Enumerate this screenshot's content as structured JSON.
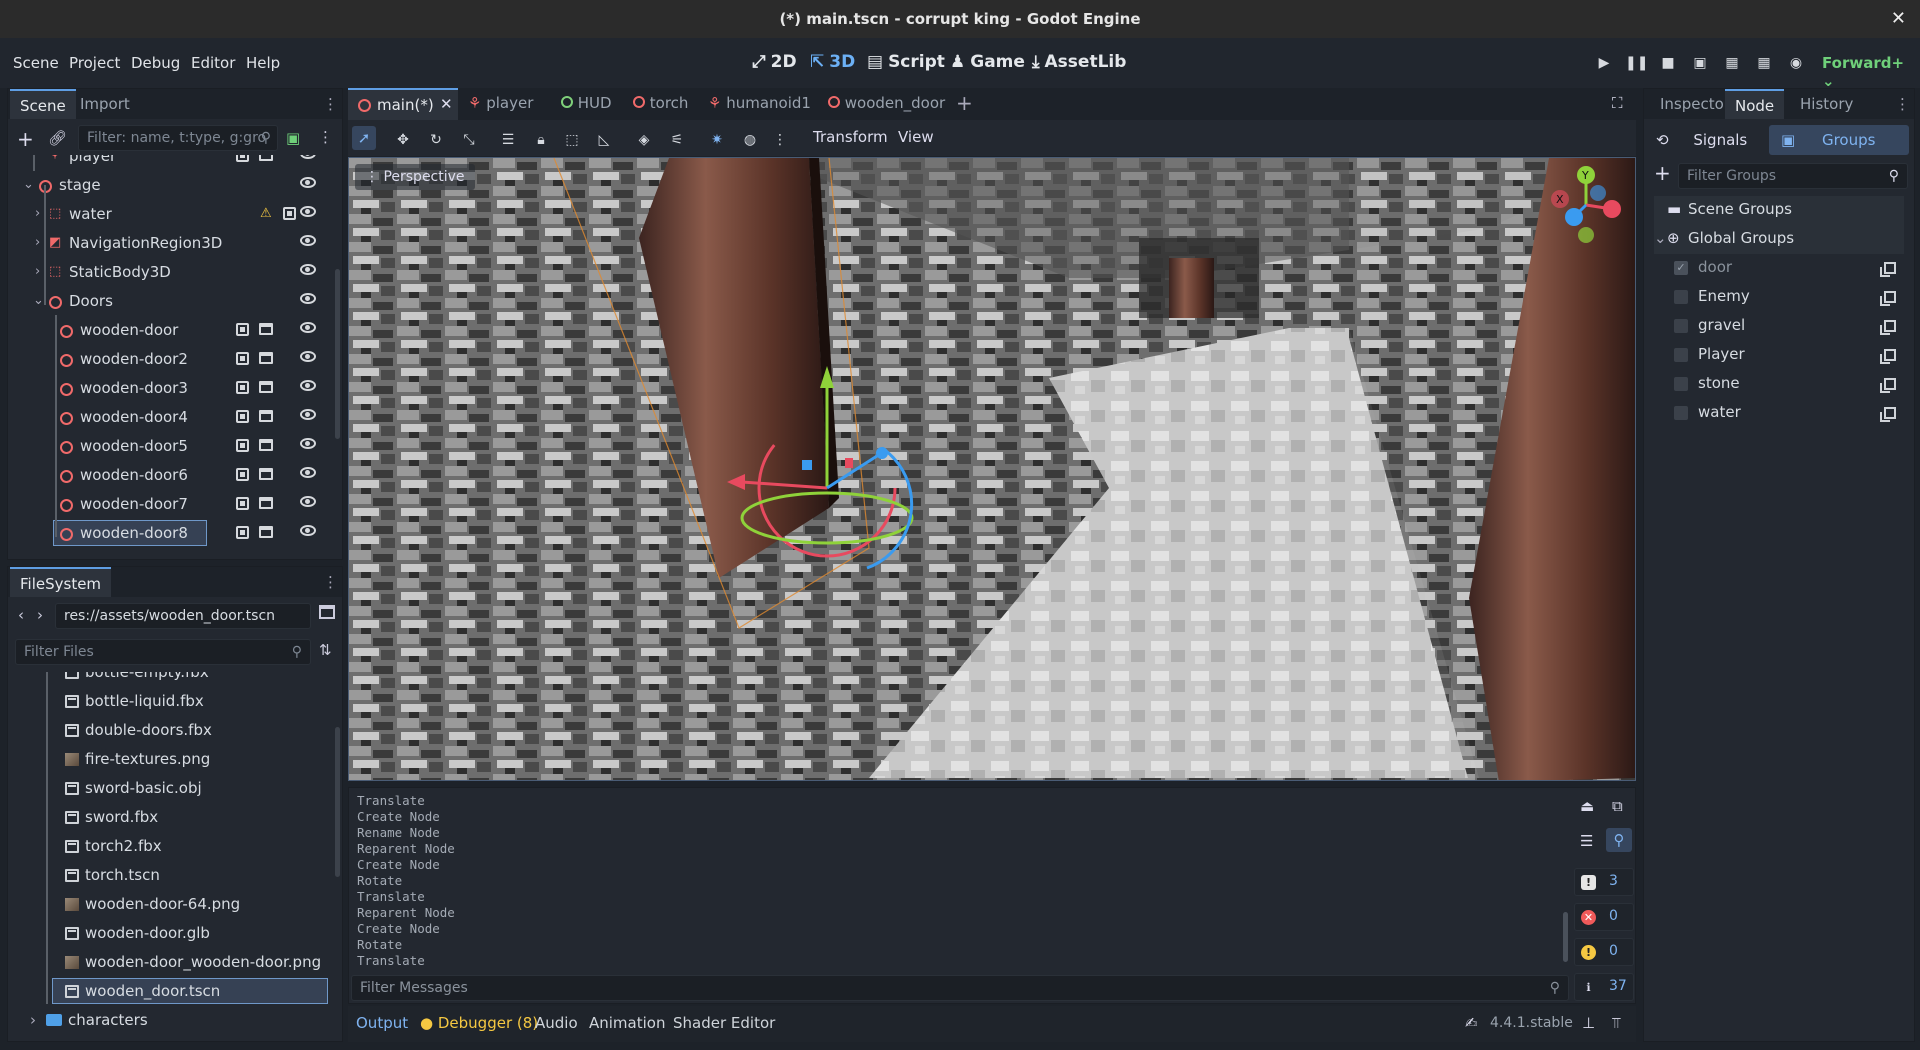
{
  "window": {
    "title": "(*) main.tscn - corrupt king - Godot Engine"
  },
  "menu": [
    "Scene",
    "Project",
    "Debug",
    "Editor",
    "Help"
  ],
  "modes": {
    "m2d": "2D",
    "m3d": "3D",
    "script": "Script",
    "game": "Game",
    "assetlib": "AssetLib"
  },
  "renderer": "Forward+",
  "scene_dock": {
    "tabs": [
      "Scene",
      "Import"
    ],
    "filter_placeholder": "Filter: name, t:type, g:gro",
    "nodes": [
      {
        "label": "player",
        "kind": "char"
      },
      {
        "label": "stage",
        "kind": "node"
      },
      {
        "label": "water",
        "kind": "box",
        "warning": true
      },
      {
        "label": "NavigationRegion3D",
        "kind": "nav"
      },
      {
        "label": "StaticBody3D",
        "kind": "box"
      },
      {
        "label": "Doors",
        "kind": "node"
      },
      {
        "label": "wooden-door",
        "kind": "node"
      },
      {
        "label": "wooden-door2",
        "kind": "node"
      },
      {
        "label": "wooden-door3",
        "kind": "node"
      },
      {
        "label": "wooden-door4",
        "kind": "node"
      },
      {
        "label": "wooden-door5",
        "kind": "node"
      },
      {
        "label": "wooden-door6",
        "kind": "node"
      },
      {
        "label": "wooden-door7",
        "kind": "node"
      },
      {
        "label": "wooden-door8",
        "kind": "node",
        "selected": true
      }
    ]
  },
  "filesystem": {
    "tab": "FileSystem",
    "path": "res://assets/wooden_door.tscn",
    "filter_placeholder": "Filter Files",
    "files": [
      {
        "label": "bottle-empty.fbx",
        "kind": "fbx"
      },
      {
        "label": "bottle-liquid.fbx",
        "kind": "fbx"
      },
      {
        "label": "double-doors.fbx",
        "kind": "fbx"
      },
      {
        "label": "fire-textures.png",
        "kind": "img"
      },
      {
        "label": "sword-basic.obj",
        "kind": "fbx"
      },
      {
        "label": "sword.fbx",
        "kind": "fbx"
      },
      {
        "label": "torch2.fbx",
        "kind": "fbx"
      },
      {
        "label": "torch.tscn",
        "kind": "fbx"
      },
      {
        "label": "wooden-door-64.png",
        "kind": "img"
      },
      {
        "label": "wooden-door.glb",
        "kind": "fbx"
      },
      {
        "label": "wooden-door_wooden-door.png",
        "kind": "img"
      },
      {
        "label": "wooden_door.tscn",
        "kind": "fbx",
        "selected": true
      },
      {
        "label": "characters",
        "kind": "folder"
      }
    ]
  },
  "editor_tabs": [
    "main(*)",
    "player",
    "HUD",
    "torch",
    "humanoid1",
    "wooden_door"
  ],
  "viewport": {
    "toolbar_menus": [
      "Transform",
      "View"
    ],
    "mode_label": "Perspective",
    "gizmo_axes": {
      "x": "X",
      "y": "Y"
    }
  },
  "output": {
    "lines": [
      "Translate",
      "Create Node",
      "Rename Node",
      "Reparent Node",
      "Create Node",
      "Rotate",
      "Translate",
      "Reparent Node",
      "Create Node",
      "Rotate",
      "Translate"
    ],
    "filter_placeholder": "Filter Messages",
    "counts": {
      "messages": "3",
      "errors": "0",
      "warnings": "0",
      "info": "37"
    }
  },
  "bottom_tabs": {
    "output": "Output",
    "debugger": "Debugger (8)",
    "audio": "Audio",
    "animation": "Animation",
    "shader": "Shader Editor"
  },
  "version": "4.4.1.stable",
  "right_dock": {
    "tabs": [
      "Inspector",
      "Node",
      "History"
    ],
    "subtabs": {
      "signals": "Signals",
      "groups": "Groups"
    },
    "filter_placeholder": "Filter Groups",
    "scene_groups": "Scene Groups",
    "global_groups": "Global Groups",
    "groups": [
      {
        "label": "door",
        "checked": true
      },
      {
        "label": "Enemy"
      },
      {
        "label": "gravel"
      },
      {
        "label": "Player"
      },
      {
        "label": "stone"
      },
      {
        "label": "water"
      }
    ]
  }
}
